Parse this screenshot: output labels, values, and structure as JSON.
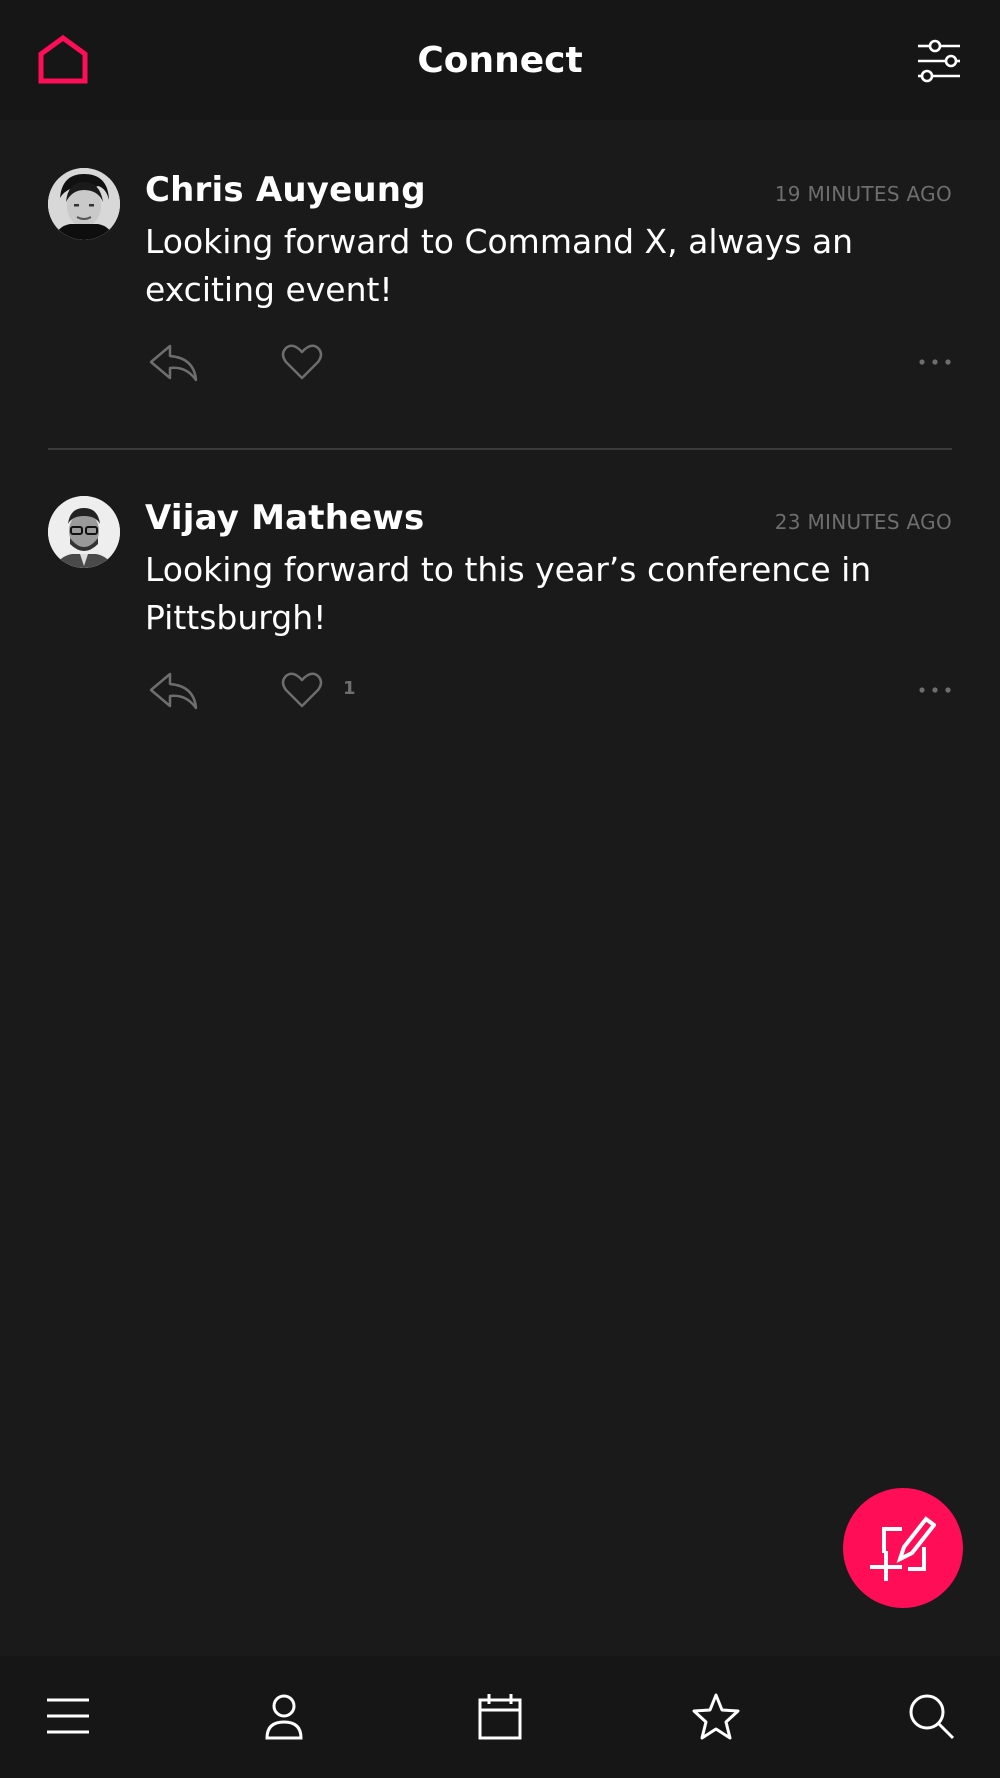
{
  "header": {
    "title": "Connect",
    "home_icon": "home-icon",
    "filter_icon": "sliders-icon"
  },
  "posts": [
    {
      "author": "Chris Auyeung",
      "time": "19 MINUTES AGO",
      "text": "Looking forward to Command X, always an exciting event!",
      "likes": ""
    },
    {
      "author": "Vijay Mathews",
      "time": "23 MINUTES AGO",
      "text": "Looking forward to this year’s conference in Pittsburgh!",
      "likes": "1"
    }
  ],
  "nav": {
    "items": [
      "menu-icon",
      "profile-icon",
      "calendar-icon",
      "star-icon",
      "search-icon"
    ]
  },
  "colors": {
    "accent": "#ff0d57",
    "background": "#1a1a1a",
    "bar": "#161616",
    "muted": "#6e6e6e"
  }
}
